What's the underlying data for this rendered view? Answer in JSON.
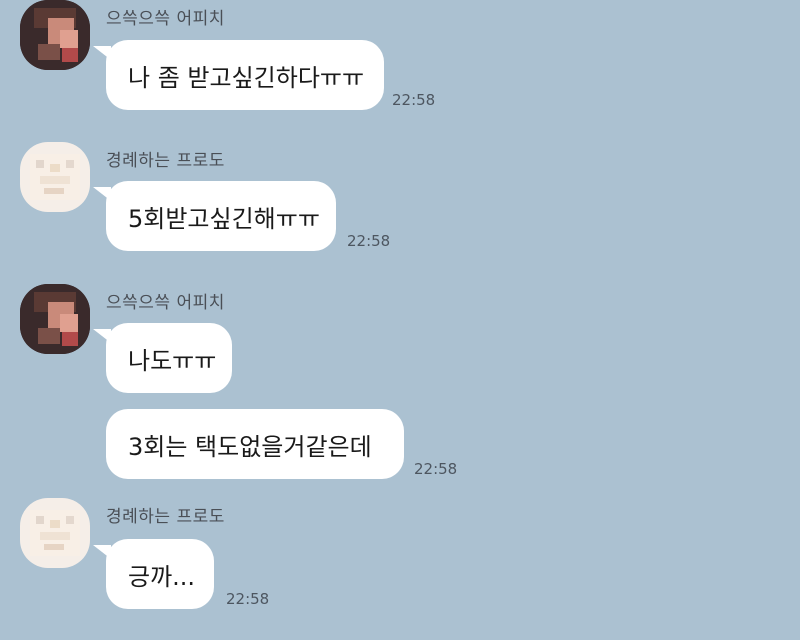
{
  "messages": [
    {
      "sender": "으쓱으쓱 어피치",
      "text": "나 좀 받고싶긴하다ㅠㅠ",
      "time": "22:58"
    },
    {
      "sender": "경례하는 프로도",
      "text": "5회받고싶긴해ㅠㅠ",
      "time": "22:58"
    },
    {
      "sender": "으쓱으쓱 어피치",
      "text": "나도ㅠㅠ",
      "time": ""
    },
    {
      "sender": "",
      "text": "3회는 택도없을거같은데",
      "time": "22:58"
    },
    {
      "sender": "경례하는 프로도",
      "text": "긍까...",
      "time": "22:58"
    }
  ]
}
